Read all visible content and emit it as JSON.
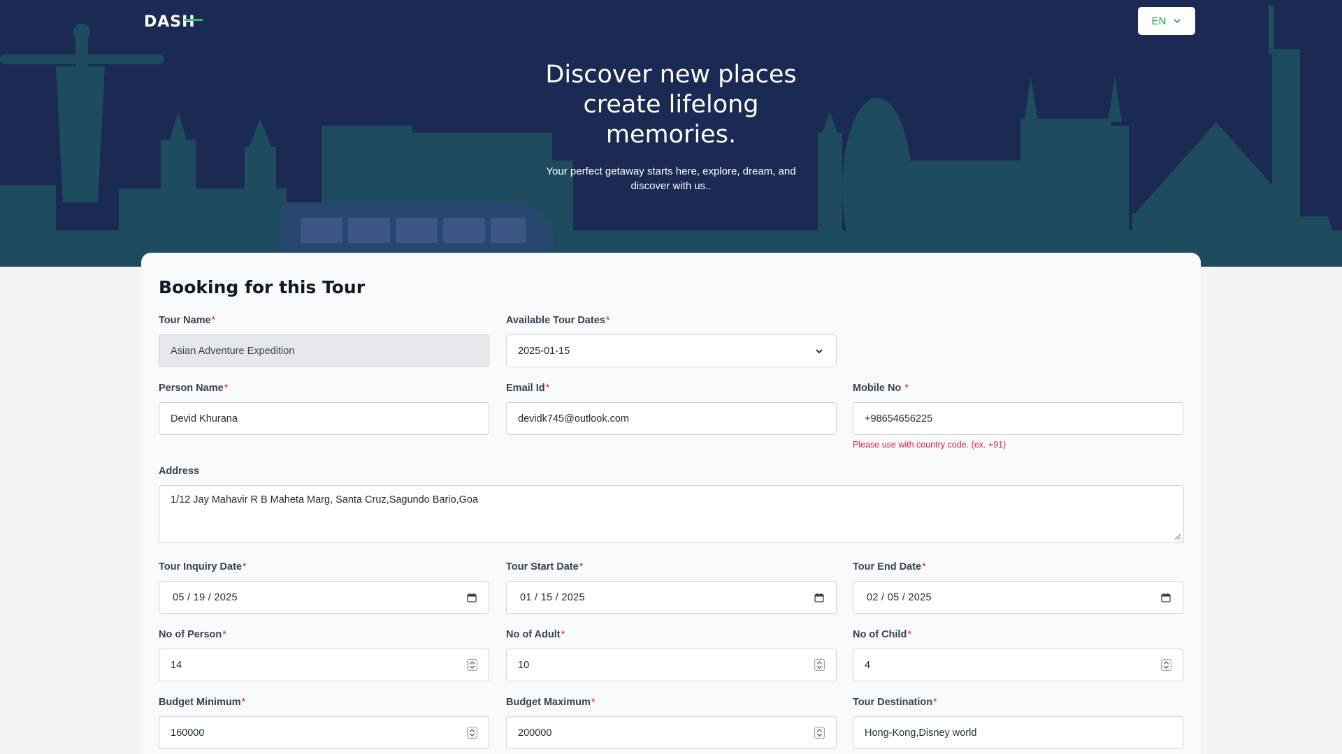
{
  "header": {
    "logo_text": "DASH",
    "language": "EN",
    "title_lines": [
      "Discover new places",
      "create lifelong",
      "memories."
    ],
    "subtitle": "Your perfect getaway starts here, explore, dream, and discover with us.."
  },
  "form": {
    "title": "Booking for this Tour",
    "tour_name": {
      "label": "Tour Name",
      "value": "Asian Adventure Expedition"
    },
    "tour_dates": {
      "label": "Available Tour Dates",
      "value": "2025-01-15"
    },
    "person_name": {
      "label": "Person Name",
      "value": "Devid Khurana"
    },
    "email": {
      "label": "Email Id",
      "value": "devidk745@outlook.com"
    },
    "mobile": {
      "label": "Mobile No ",
      "value": "+98654656225",
      "hint": "Please use with country code. (ex. +91)"
    },
    "address": {
      "label": "Address",
      "value": "1/12 Jay Mahavir R B Maheta Marg, Santa Cruz,Sagundo Bario,Goa"
    },
    "inquiry_date": {
      "label": "Tour Inquiry Date",
      "value": "05 / 19 / 2025"
    },
    "start_date": {
      "label": "Tour Start Date",
      "value": "01 / 15 / 2025"
    },
    "end_date": {
      "label": "Tour End Date",
      "value": "02 / 05 / 2025"
    },
    "num_person": {
      "label": "No of Person",
      "value": "14"
    },
    "num_adult": {
      "label": "No of Adult",
      "value": "10"
    },
    "num_child": {
      "label": "No of Child",
      "value": "4"
    },
    "budget_min": {
      "label": "Budget Minimum",
      "value": "160000"
    },
    "budget_max": {
      "label": "Budget Maximum",
      "value": "200000"
    },
    "destination": {
      "label": "Tour Destination",
      "value": "Hong-Kong,Disney world"
    },
    "required_mark": "*"
  },
  "colors": {
    "hero_bg": "#1b2a52",
    "skyline": "#1e4a5a",
    "accent_green": "#16a34a",
    "required": "#e11d48"
  }
}
